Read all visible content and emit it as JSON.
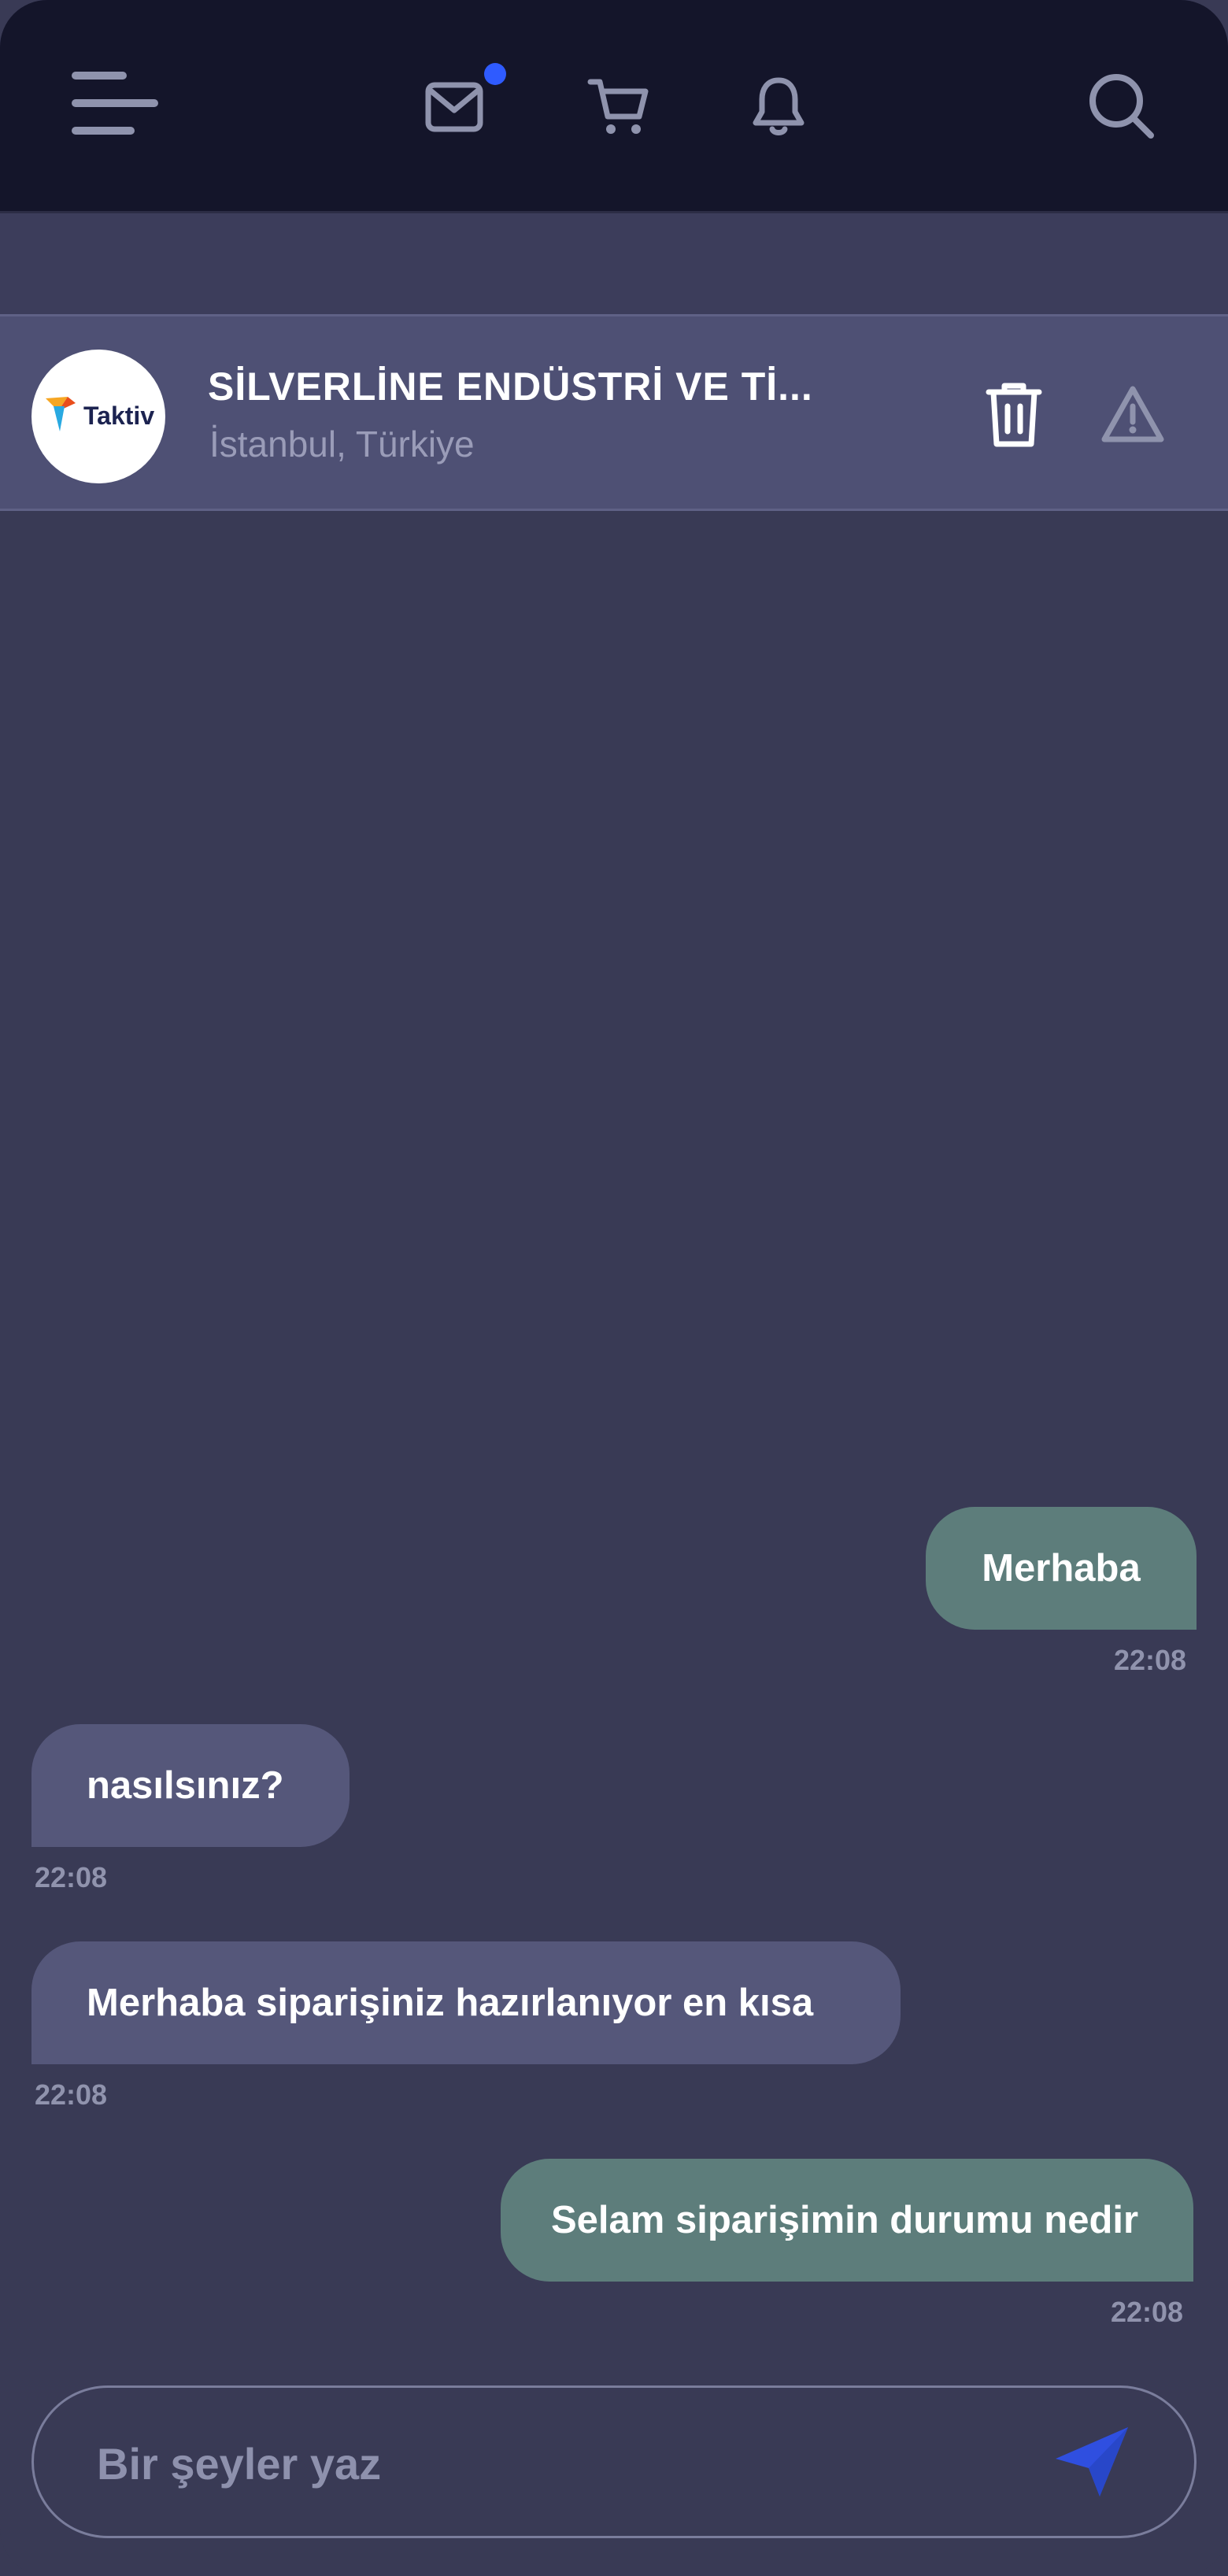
{
  "header": {
    "icons": [
      "menu-icon",
      "mail-icon",
      "cart-icon",
      "bell-icon",
      "search-icon"
    ],
    "mail_has_badge": true,
    "badge_color": "#2f5bff"
  },
  "contact": {
    "avatar_logo": "Taktiv",
    "name": "SİLVERLİNE ENDÜSTRİ VE Tİ...",
    "location": "İstanbul, Türkiye",
    "actions": [
      "trash-icon",
      "report-warning-icon"
    ]
  },
  "messages": [
    {
      "direction": "sent",
      "text": "Merhaba",
      "time": "22:08"
    },
    {
      "direction": "received",
      "text": "nasılsınız?",
      "time": "22:08"
    },
    {
      "direction": "received",
      "text": "Merhaba siparişiniz hazırlanıyor en kısa",
      "time": "22:08"
    },
    {
      "direction": "sent",
      "text": "Selam siparişimin durumu nedir",
      "time": "22:08"
    }
  ],
  "composer": {
    "placeholder": "Bir şeyler yaz",
    "send_icon": "send-icon",
    "send_color": "#2f4fe0"
  },
  "colors": {
    "background": "#393a55",
    "header": "#14152a",
    "sent_bubble": "#5d7d7b",
    "received_bubble": "#55577a"
  }
}
